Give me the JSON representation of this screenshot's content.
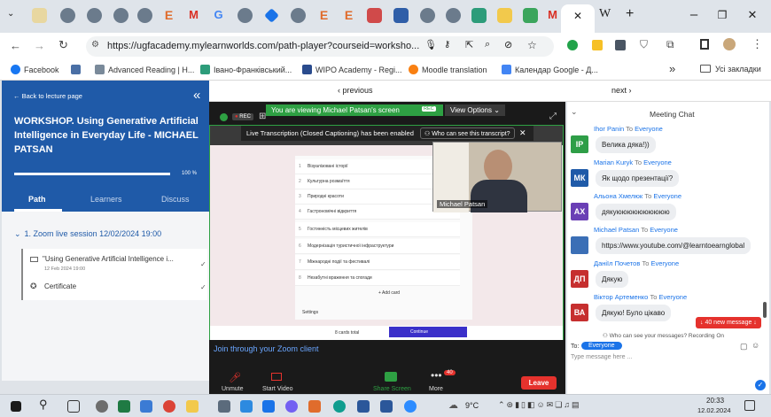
{
  "browser": {
    "active_tab_label": "W",
    "url": "https://ugfacademy.mylearnworlds.com/path-player?courseid=worksho...",
    "window_controls": {
      "minimize": "–",
      "maximize": "❐",
      "close": "✕"
    },
    "bookmarks": [
      "Facebook",
      "Advanced Reading | H...",
      "Івано-Франківський...",
      "WIPO Academy - Regi...",
      "Moodle translation",
      "Календар Google - Д..."
    ],
    "bookmarks_more": "»",
    "bookmarks_folder": "Усі закладки"
  },
  "sidebar": {
    "back": "← Back to lecture page",
    "collapse": "«",
    "title": "WORKSHOP. Using Generative Artificial Intelligence in Everyday Life - MICHAEL PATSAN",
    "progress_label": "100 %",
    "progress": 1.0,
    "tabs": [
      "Path",
      "Learners",
      "Discuss"
    ],
    "section": "1. Zoom live session 12/02/2024 19:00",
    "items": [
      {
        "title": "\"Using Generative Artificial Intelligence i...",
        "date": "12 Feb 2024 19:00",
        "check": "✓"
      },
      {
        "title": "Certificate",
        "date": "",
        "check": "✓"
      }
    ]
  },
  "nav": {
    "previous": "‹ previous",
    "next": "next ›"
  },
  "zoom": {
    "banner": "You are viewing Michael Patsan's screen",
    "banner_rec": "REC",
    "view_options": "View Options",
    "rec": "REC",
    "transcription": "Live Transcription (Closed Captioning) has been enabled",
    "transcript_question": "Who can see this transcript?",
    "participant_name": "Michael Patsan",
    "join_text": "Join through your Zoom client",
    "shared_rows": [
      "Візуалізовані історії",
      "Культурна розмаїття",
      "Природні красоти",
      "Гастрономічні відкриття",
      "Гостинність місцевих жителів",
      "Модернізація туристичної інфраструктури",
      "Міжнародні події та фестивалі",
      "Незабутні враження та спогади"
    ],
    "add_card": "+ Add card",
    "settings_label": "Settings",
    "cards_total": "8 cards total",
    "continue": "Continue",
    "toolbar": {
      "unmute": "Unmute",
      "start_video": "Start Video",
      "share_screen": "Share Screen",
      "more": "More",
      "more_badge": "40",
      "leave": "Leave"
    }
  },
  "chat": {
    "title": "Meeting Chat",
    "messages": [
      {
        "initials": "IP",
        "color": "#2e9e47",
        "sender": "Ihor Panin",
        "to": "Everyone",
        "text": "Велика дяка!))"
      },
      {
        "initials": "МК",
        "color": "#1f5aa8",
        "sender": "Marian Kuryk",
        "to": "Everyone",
        "text": "Як щодо презентації?"
      },
      {
        "initials": "АХ",
        "color": "#6a3fb5",
        "sender": "Альона Хмелюк",
        "to": "Everyone",
        "text": "дякуюююююююююю"
      },
      {
        "initials": "",
        "color": "#3b6fb6",
        "sender": "Michael Patsan",
        "to": "Everyone",
        "text": "https://www.youtube.com/@learntoearnglobal"
      },
      {
        "initials": "ДП",
        "color": "#c62f2f",
        "sender": "Даніїл Почетов",
        "to": "Everyone",
        "text": "Дякую"
      },
      {
        "initials": "ВА",
        "color": "#c62f2f",
        "sender": "Віктор Артеменко",
        "to": "Everyone",
        "text": "Дякую! Було цікаво"
      }
    ],
    "to_word": "To",
    "new_messages": "↓ 40 new message ↓",
    "who_can_see": "Who can see your messages? Recording On",
    "to_label": "To:",
    "recipient": "Everyone",
    "placeholder": "Type message here ..."
  },
  "taskbar": {
    "weather": "9°C",
    "time": "20:33",
    "date": "12.02.2024"
  }
}
